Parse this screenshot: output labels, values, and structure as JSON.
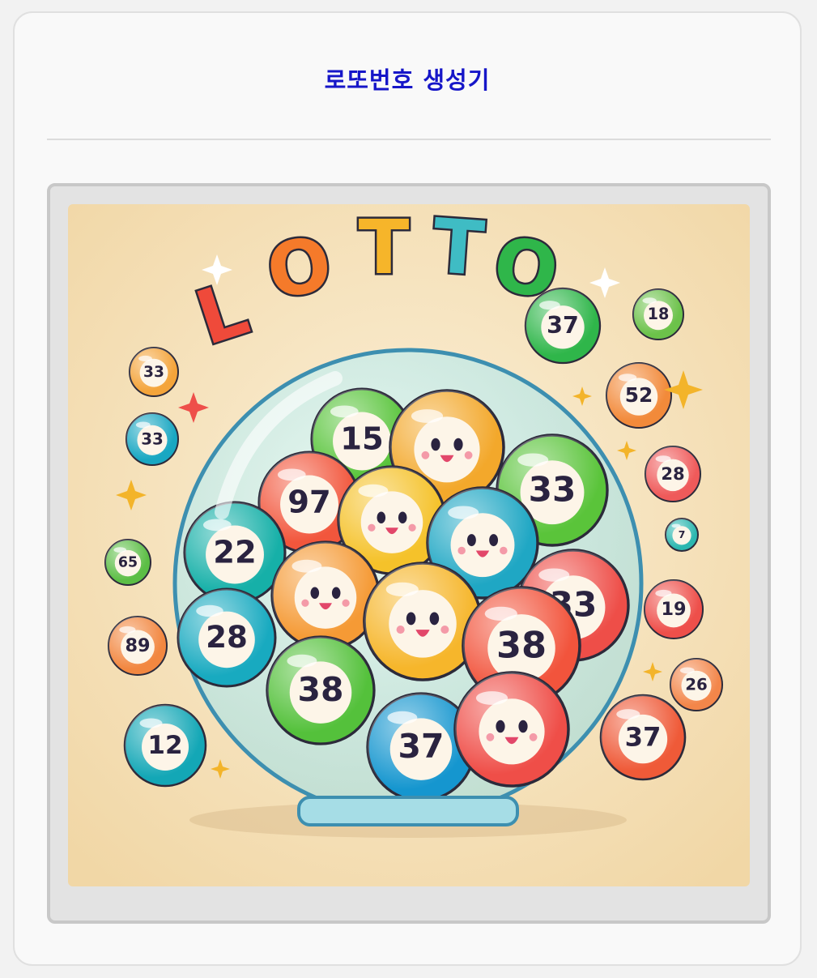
{
  "page": {
    "title": "로또번호 생성기"
  },
  "illustration": {
    "logo_text": "LOTTO",
    "jar_balls": [
      {
        "label": "15",
        "color": "#58c43a"
      },
      {
        "label": "",
        "color": "#f3a82b"
      },
      {
        "label": "33",
        "color": "#5ac43a"
      },
      {
        "label": "97",
        "color": "#f2563c"
      },
      {
        "label": "",
        "color": "#f5c22a"
      },
      {
        "label": "",
        "color": "#1fa7c4"
      },
      {
        "label": "22",
        "color": "#16b0a8"
      },
      {
        "label": "33",
        "color": "#ee4e48"
      },
      {
        "label": "",
        "color": "#f59a35"
      },
      {
        "label": "",
        "color": "#f6b62b"
      },
      {
        "label": "38",
        "color": "#f2543c"
      },
      {
        "label": "28",
        "color": "#18aac0"
      },
      {
        "label": "38",
        "color": "#54c13b"
      },
      {
        "label": "37",
        "color": "#1596cf"
      },
      {
        "label": "",
        "color": "#ef4e48"
      }
    ],
    "outer_balls": [
      {
        "label": "37",
        "color": "#2fb64a"
      },
      {
        "label": "18",
        "color": "#6cc24a"
      },
      {
        "label": "33",
        "color": "#f4a43a"
      },
      {
        "label": "52",
        "color": "#f28a3a"
      },
      {
        "label": "33",
        "color": "#19a7c2"
      },
      {
        "label": "28",
        "color": "#ef5a5a"
      },
      {
        "label": "7",
        "color": "#2cb7b0"
      },
      {
        "label": "65",
        "color": "#5cbe45"
      },
      {
        "label": "19",
        "color": "#ee4f4a"
      },
      {
        "label": "89",
        "color": "#f28740"
      },
      {
        "label": "26",
        "color": "#f3864a"
      },
      {
        "label": "12",
        "color": "#13a7b6"
      },
      {
        "label": "37",
        "color": "#ef5a38"
      }
    ]
  },
  "colors": {
    "title": "#1616c8",
    "art_background": "#f6e2b8"
  }
}
